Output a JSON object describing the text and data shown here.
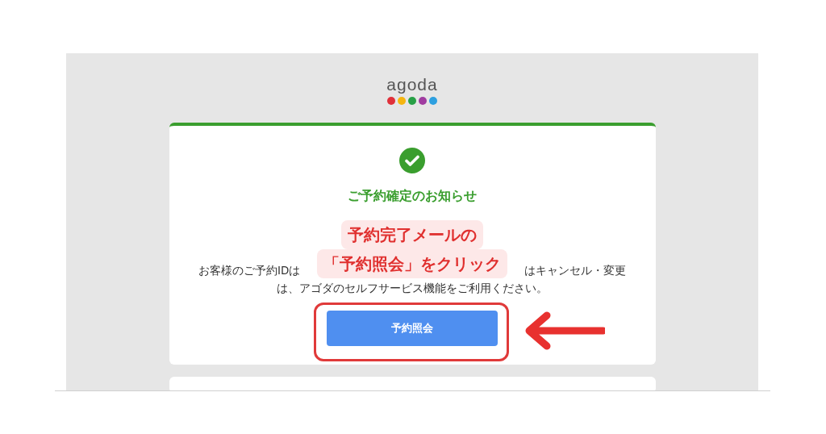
{
  "logo": {
    "text": "agoda",
    "dots": [
      {
        "color": "#e0303a"
      },
      {
        "color": "#f5b50f"
      },
      {
        "color": "#28a046"
      },
      {
        "color": "#a03ca0"
      },
      {
        "color": "#2ea0e0"
      }
    ]
  },
  "card": {
    "title": "ご予約確定のお知らせ",
    "message_lines": [
      {
        "parts": [
          "お客様のご予約IDは",
          "はキャンセル・変更"
        ]
      },
      {
        "parts": [
          "は、アゴダのセルフサービス機能をご利用ください。"
        ]
      }
    ],
    "button": "予約照会"
  },
  "annotation": {
    "lines": [
      "予約完了メールの",
      "「予約照会」をクリック"
    ]
  }
}
